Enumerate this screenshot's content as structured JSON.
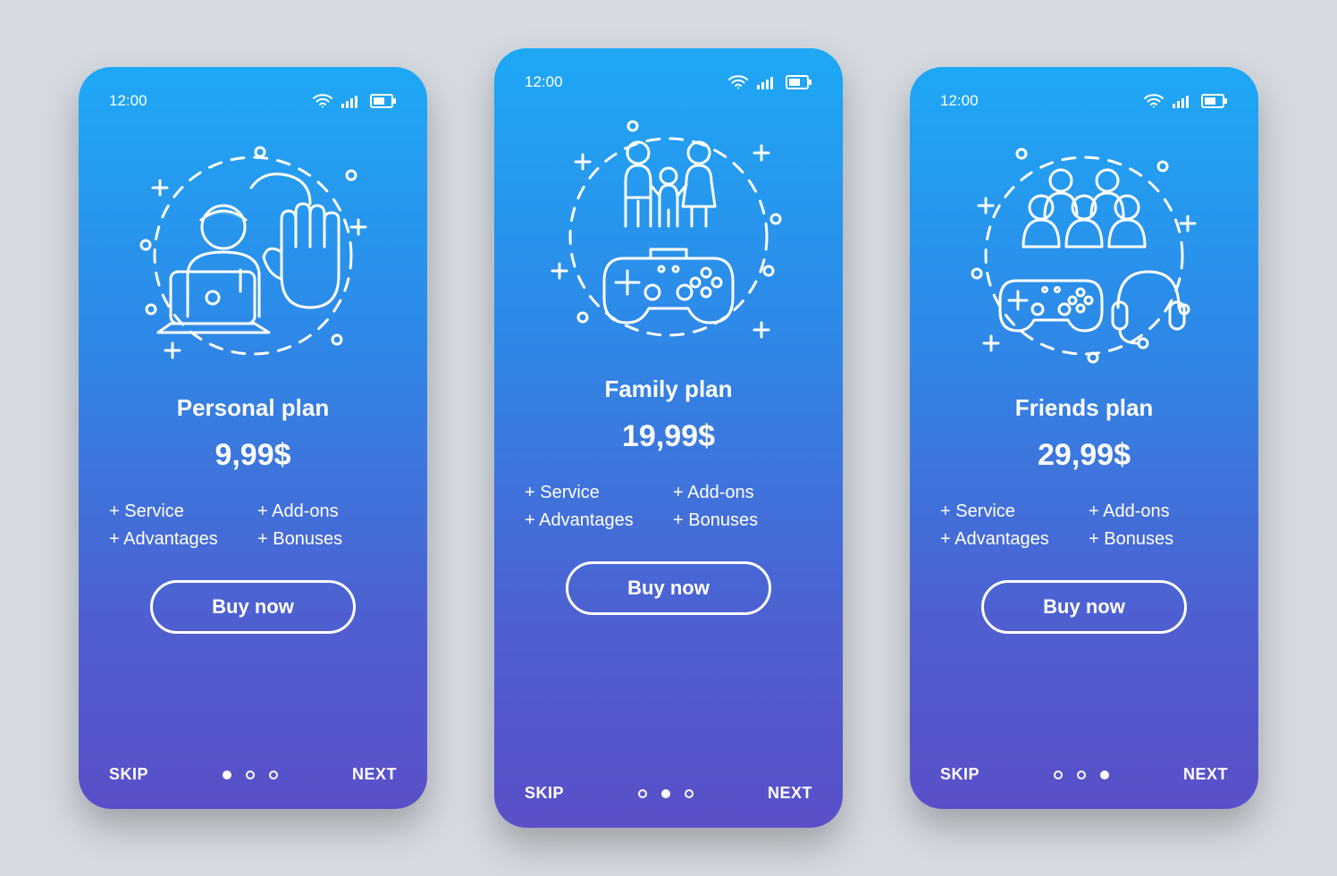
{
  "statusbar": {
    "time": "12:00"
  },
  "nav": {
    "skip": "SKIP",
    "next": "NEXT",
    "cta": "Buy now"
  },
  "features": {
    "service": "+ Service",
    "addons": "+ Add-ons",
    "advantages": "+ Advantages",
    "bonuses": "+ Bonuses"
  },
  "plans": [
    {
      "title": "Personal plan",
      "price": "9,99$",
      "activeDot": 0
    },
    {
      "title": "Family plan",
      "price": "19,99$",
      "activeDot": 1
    },
    {
      "title": "Friends plan",
      "price": "29,99$",
      "activeDot": 2
    }
  ]
}
